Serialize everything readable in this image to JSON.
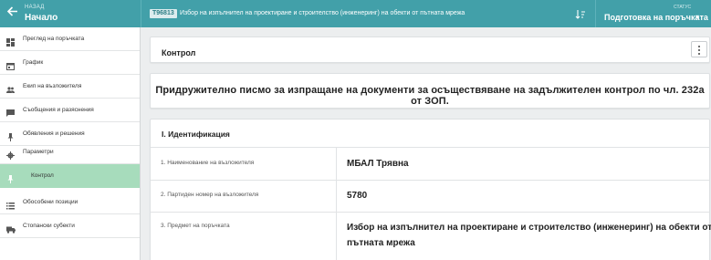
{
  "topbar": {
    "back_small": "НАЗАД",
    "back_title": "Начало",
    "procedure_id": "Т96813",
    "procedure_title": "Избор на изпълнител на проектиране и строителство (инженеринг) на обекти от пътната мрежа",
    "status_label": "СТАТУС",
    "status_value": "Подготовка на поръчката",
    "icons": {
      "back": "arrow-left-icon",
      "sort": "sort-lines-icon",
      "status": "chevron-down-icon"
    }
  },
  "sidebar": {
    "items": [
      {
        "label": "Преглед на поръчката",
        "icon": "dashboard-icon"
      },
      {
        "label": "График",
        "icon": "calendar-icon"
      },
      {
        "label": "Екип на възложителя",
        "icon": "people-icon"
      },
      {
        "label": "Съобщения и разяснения",
        "icon": "chat-icon"
      },
      {
        "label": "Обявления и решения",
        "icon": "pin-icon"
      },
      {
        "label": "Параметри",
        "icon": "gear-icon"
      },
      {
        "label": "Контрол",
        "icon": "pin-icon"
      },
      {
        "label": "Обособени позиции",
        "icon": "list-icon"
      },
      {
        "label": "Стопански субекти",
        "icon": "truck-icon"
      }
    ],
    "active_index": 6,
    "active_color": "#a7dcbc"
  },
  "main": {
    "control_title": "Контрол",
    "banner": "Придружително писмо за изпращане на документи за осъществяване на задължителен контрол по чл. 232а от ЗОП.",
    "section_title": "I. Идентификация",
    "rows": [
      {
        "label": "1. Наименование на възложителя",
        "value": "МБАЛ Трявна"
      },
      {
        "label": "2. Партиден номер на възложителя",
        "value": "5780"
      },
      {
        "label": "3. Предмет на поръчката",
        "value_line1": "Избор на изпълнител на проектиране и строителство (инженеринг) на обекти от",
        "value_line2": "пътната мрежа"
      }
    ]
  },
  "colors": {
    "header": "#42a0a9",
    "background": "#eceeef",
    "active_item": "#a7dcbc"
  }
}
